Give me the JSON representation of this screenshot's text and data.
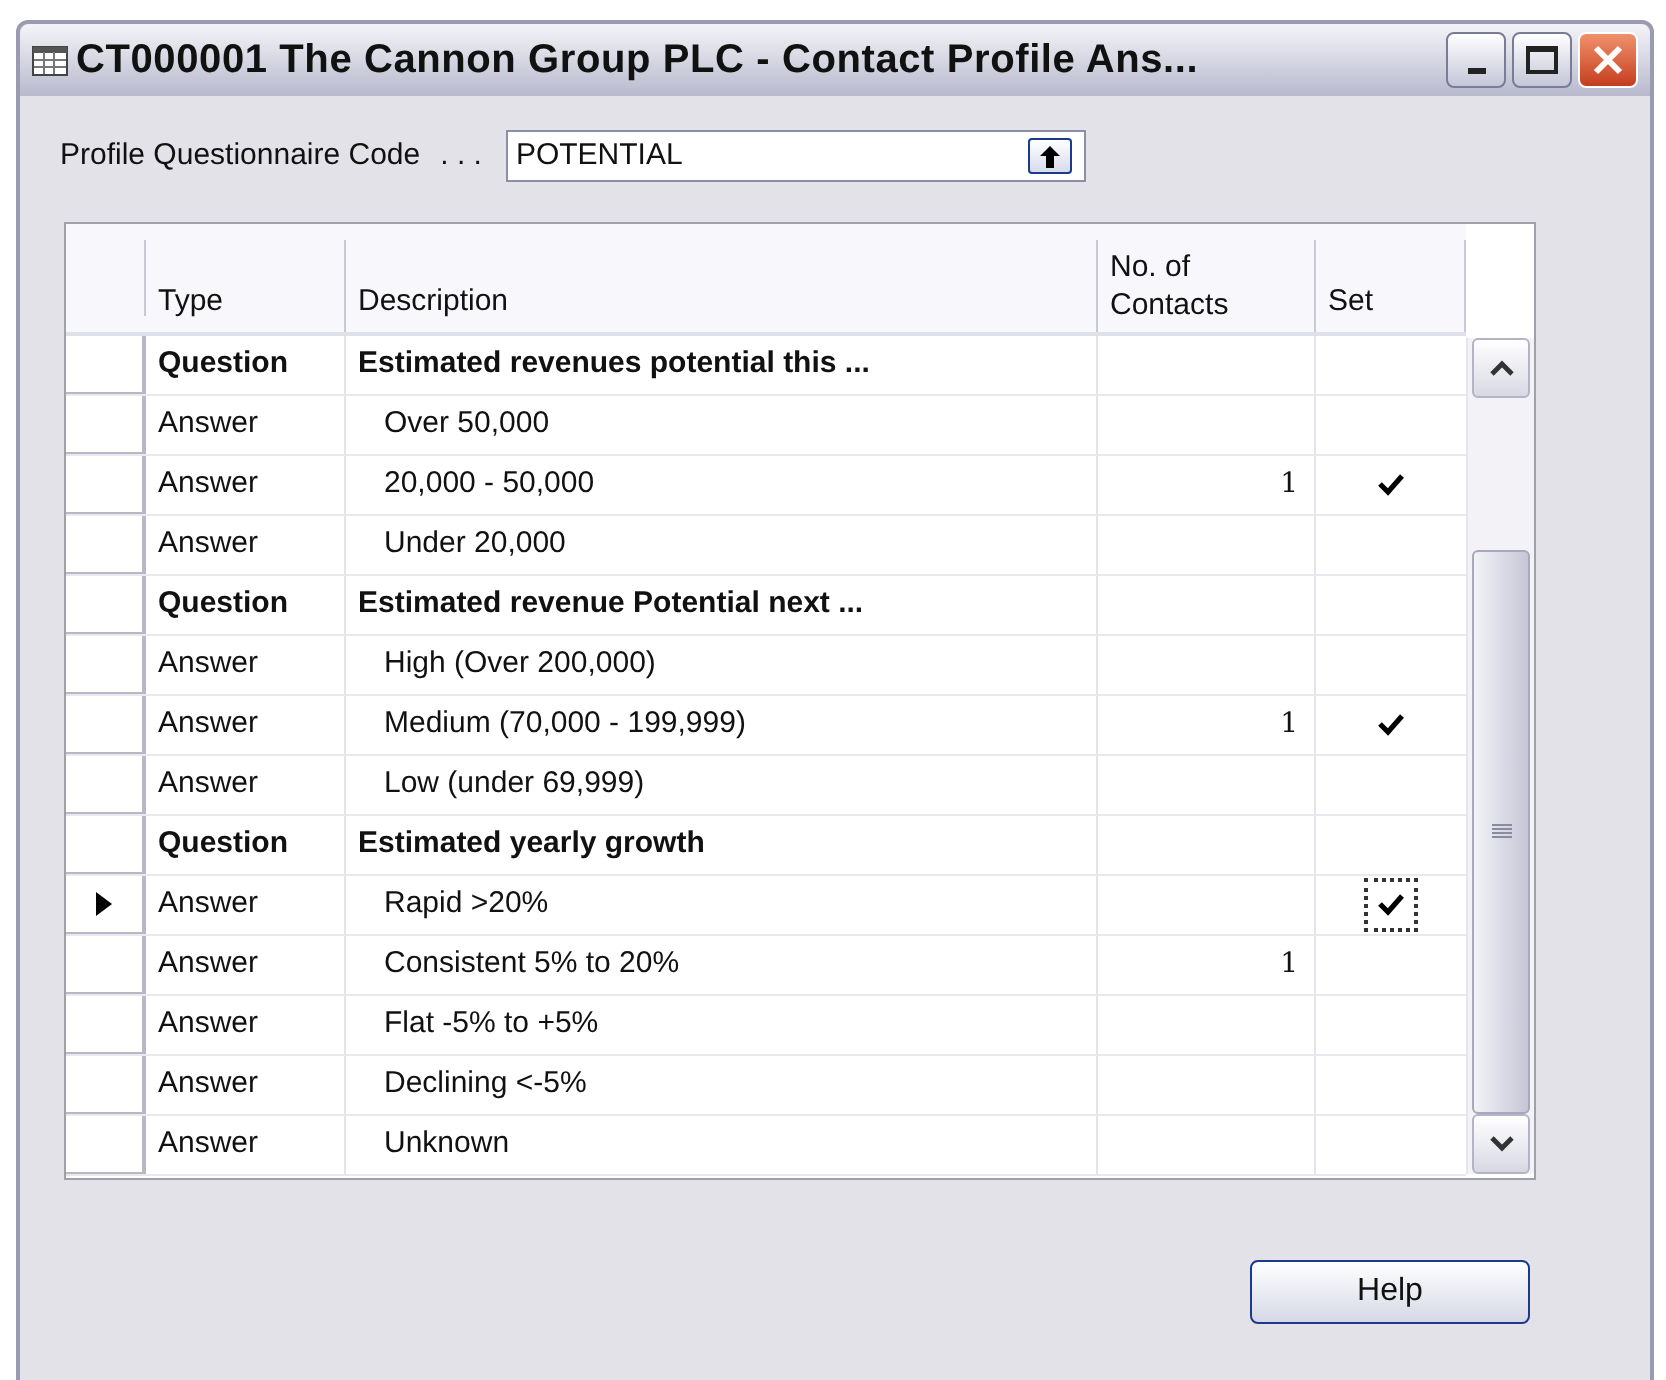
{
  "window": {
    "title": "CT000001 The Cannon Group PLC - Contact Profile Ans..."
  },
  "code_field": {
    "label": "Profile Questionnaire Code",
    "dots": ". . .",
    "value": "POTENTIAL"
  },
  "table": {
    "columns": [
      {
        "label": "Type"
      },
      {
        "label": "Description"
      },
      {
        "label": "No. of Contacts"
      },
      {
        "label": "Set"
      }
    ],
    "rows": [
      {
        "kind": "question",
        "type": "Question",
        "description": "Estimated revenues potential this ...",
        "contacts": "",
        "set": false,
        "current": false
      },
      {
        "kind": "answer",
        "type": "Answer",
        "description": "Over 50,000",
        "contacts": "",
        "set": false,
        "current": false
      },
      {
        "kind": "answer",
        "type": "Answer",
        "description": "20,000 - 50,000",
        "contacts": "1",
        "set": true,
        "current": false
      },
      {
        "kind": "answer",
        "type": "Answer",
        "description": "Under 20,000",
        "contacts": "",
        "set": false,
        "current": false
      },
      {
        "kind": "question",
        "type": "Question",
        "description": "Estimated revenue Potential next ...",
        "contacts": "",
        "set": false,
        "current": false
      },
      {
        "kind": "answer",
        "type": "Answer",
        "description": "High (Over 200,000)",
        "contacts": "",
        "set": false,
        "current": false
      },
      {
        "kind": "answer",
        "type": "Answer",
        "description": "Medium (70,000 - 199,999)",
        "contacts": "1",
        "set": true,
        "current": false
      },
      {
        "kind": "answer",
        "type": "Answer",
        "description": "Low (under 69,999)",
        "contacts": "",
        "set": false,
        "current": false
      },
      {
        "kind": "question",
        "type": "Question",
        "description": "Estimated yearly growth",
        "contacts": "",
        "set": false,
        "current": false
      },
      {
        "kind": "answer",
        "type": "Answer",
        "description": "Rapid >20%",
        "contacts": "",
        "set": true,
        "current": true
      },
      {
        "kind": "answer",
        "type": "Answer",
        "description": "Consistent 5% to 20%",
        "contacts": "1",
        "set": false,
        "current": false
      },
      {
        "kind": "answer",
        "type": "Answer",
        "description": "Flat -5% to +5%",
        "contacts": "",
        "set": false,
        "current": false
      },
      {
        "kind": "answer",
        "type": "Answer",
        "description": "Declining <-5%",
        "contacts": "",
        "set": false,
        "current": false
      },
      {
        "kind": "answer",
        "type": "Answer",
        "description": "Unknown",
        "contacts": "",
        "set": false,
        "current": false
      }
    ]
  },
  "buttons": [
    {
      "label": "Help"
    }
  ]
}
